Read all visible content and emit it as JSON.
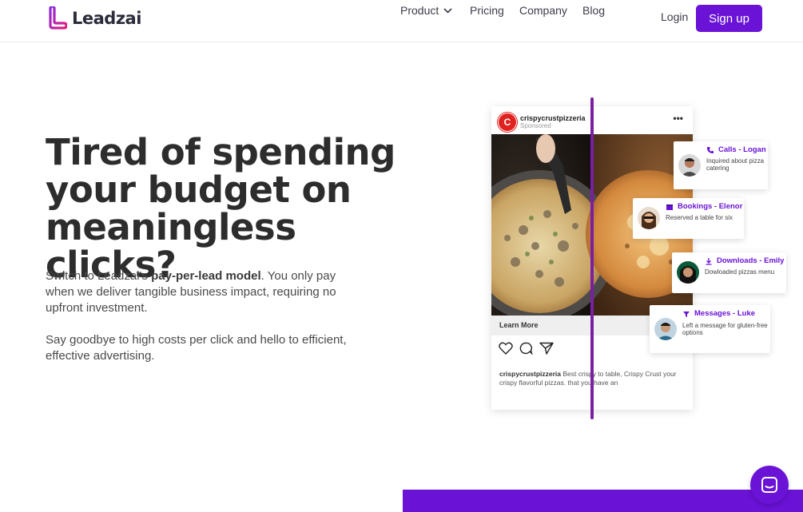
{
  "nav": {
    "logo_text": "Leadzai",
    "links": [
      "Product",
      "Pricing",
      "Company",
      "Blog"
    ],
    "login": "Login",
    "signup": "Sign up"
  },
  "hero": {
    "title": "Tired of spending your budget on meaningless clicks?",
    "p1_before": "Switch to Leadzai's ",
    "p1_bold": "pay-per-lead model",
    "p1_after": ". You only pay when we deliver tangible business impact, requiring no upfront investment.",
    "p2": "Say goodbye to high costs per click and hello to efficient, effective advertising."
  },
  "post": {
    "username": "crispycrustpizzeria",
    "sponsored": "Sponsored",
    "learn_more": "Learn More",
    "caption_user": "crispycrustpizzeria",
    "caption_text": " Best crispy to table, Crispy Crust your crispy flavorful pizzas. that you have an"
  },
  "leads": [
    {
      "title": "Calls - Logan",
      "desc": "Inquired about pizza catering",
      "icon": "phone-icon"
    },
    {
      "title": "Bookings - Elenor",
      "desc": "Reserved a table for six",
      "icon": "calendar-icon"
    },
    {
      "title": "Downloads - Emily",
      "desc": "Dowloaded pizzas menu",
      "icon": "download-icon"
    },
    {
      "title": "Messages - Luke",
      "desc": "Left a message for gluten-free options",
      "icon": "funnel-icon"
    }
  ],
  "colors": {
    "accent": "#6a12d6",
    "divider": "#7b1fa2",
    "logo_pink": "#d1207a"
  }
}
